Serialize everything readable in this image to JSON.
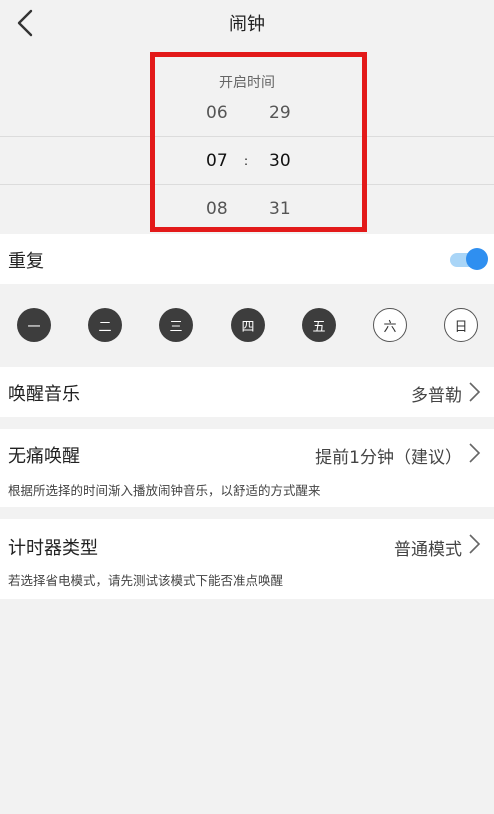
{
  "header": {
    "title": "闹钟",
    "back_icon": "chevron-left-icon"
  },
  "picker": {
    "title": "开启时间",
    "rows": [
      {
        "hour": "06",
        "minute": "29"
      },
      {
        "hour": "07",
        "minute": "30",
        "separator": ":"
      },
      {
        "hour": "08",
        "minute": "31"
      }
    ]
  },
  "repeat": {
    "label": "重复",
    "enabled": true,
    "accent": "#2f8ff0"
  },
  "days": [
    {
      "label": "一",
      "selected": true
    },
    {
      "label": "二",
      "selected": true
    },
    {
      "label": "三",
      "selected": true
    },
    {
      "label": "四",
      "selected": true
    },
    {
      "label": "五",
      "selected": true
    },
    {
      "label": "六",
      "selected": false
    },
    {
      "label": "日",
      "selected": false
    }
  ],
  "music": {
    "label": "唤醒音乐",
    "value": "多普勒"
  },
  "gentle": {
    "label": "无痛唤醒",
    "value": "提前1分钟（建议）",
    "description": "根据所选择的时间渐入播放闹钟音乐，以舒适的方式醒来"
  },
  "timer": {
    "label": "计时器类型",
    "value": "普通模式",
    "description": "若选择省电模式，请先测试该模式下能否准点唤醒"
  }
}
